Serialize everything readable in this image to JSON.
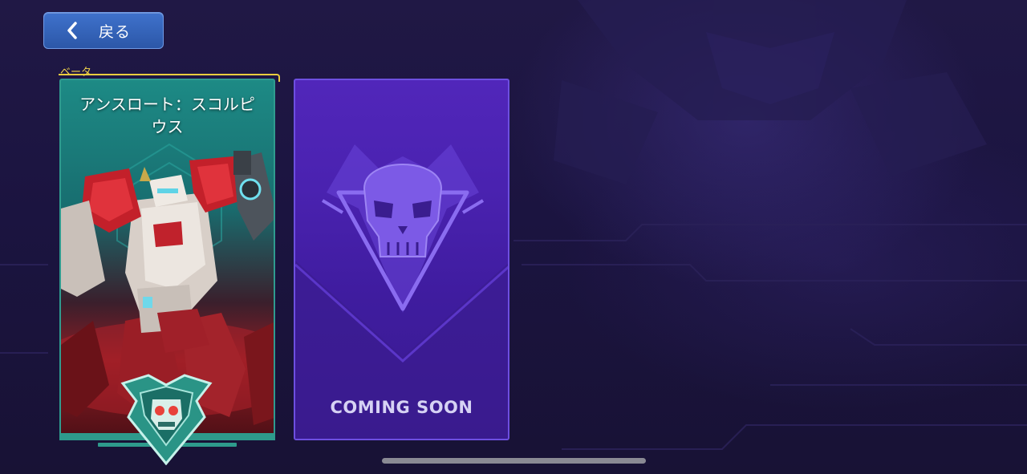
{
  "nav": {
    "back_label": "戻る",
    "back_icon": "chevron-left-icon"
  },
  "cards": [
    {
      "badge": "ベータ",
      "title": "アンスロート：スコルピウス",
      "emblem_icon": "faction-skull-emblem-icon",
      "frame_color": "#2f9b8f",
      "badge_color": "#f3d54a"
    },
    {
      "status": "COMING SOON",
      "emblem_icon": "skull-emblem-icon",
      "frame_color": "#6d4fe0"
    }
  ],
  "colors": {
    "background": "#1a1435",
    "back_button": "#3565bb",
    "hero_teal": "#1d8a85",
    "hero_red": "#8e1d24",
    "soon_purple": "#4a22b0"
  }
}
